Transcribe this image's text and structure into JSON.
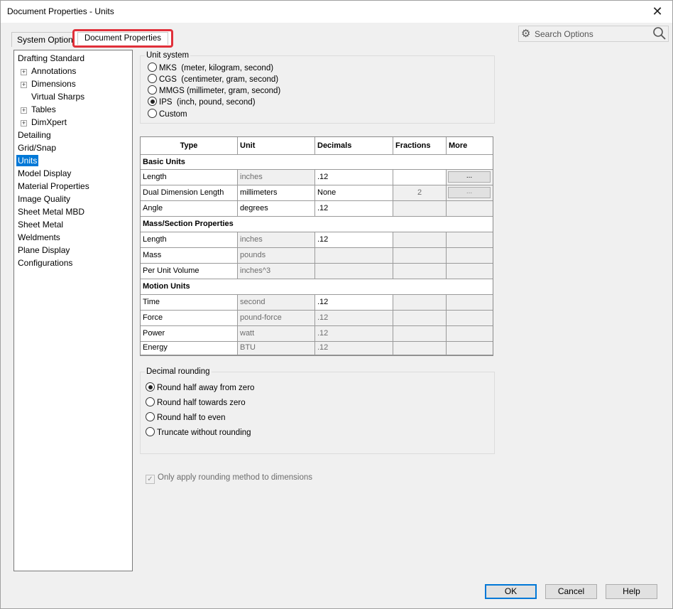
{
  "window": {
    "title": "Document Properties - Units",
    "close": "✕"
  },
  "tabs": {
    "system": "System Options",
    "document": "Document Properties"
  },
  "search": {
    "placeholder": "Search Options"
  },
  "tree": {
    "items": [
      {
        "label": "Drafting Standard"
      },
      {
        "label": "Annotations"
      },
      {
        "label": "Dimensions"
      },
      {
        "label": "Virtual Sharps"
      },
      {
        "label": "Tables"
      },
      {
        "label": "DimXpert"
      },
      {
        "label": "Detailing"
      },
      {
        "label": "Grid/Snap"
      },
      {
        "label": "Units"
      },
      {
        "label": "Model Display"
      },
      {
        "label": "Material Properties"
      },
      {
        "label": "Image Quality"
      },
      {
        "label": "Sheet Metal MBD"
      },
      {
        "label": "Sheet Metal"
      },
      {
        "label": "Weldments"
      },
      {
        "label": "Plane Display"
      },
      {
        "label": "Configurations"
      }
    ],
    "selected": "Units"
  },
  "unit_system": {
    "label": "Unit system",
    "options": [
      {
        "label": "MKS  (meter, kilogram, second)",
        "selected": false
      },
      {
        "label": "CGS  (centimeter, gram, second)",
        "selected": false
      },
      {
        "label": "MMGS (millimeter, gram, second)",
        "selected": false
      },
      {
        "label": "IPS  (inch, pound, second)",
        "selected": true
      },
      {
        "label": "Custom",
        "selected": false
      }
    ]
  },
  "table": {
    "headers": {
      "type": "Type",
      "unit": "Unit",
      "decimals": "Decimals",
      "fractions": "Fractions",
      "more": "More"
    },
    "sections": {
      "basic": "Basic Units",
      "mass": "Mass/Section Properties",
      "motion": "Motion Units"
    },
    "rows": [
      {
        "type": "Length",
        "unit": "inches",
        "decimals": ".12",
        "fractions": "",
        "more": "..."
      },
      {
        "type": "Dual Dimension Length",
        "unit": "millimeters",
        "decimals": "None",
        "fractions": "2",
        "more": "..."
      },
      {
        "type": "Angle",
        "unit": "degrees",
        "decimals": ".12",
        "fractions": "",
        "more": ""
      },
      {
        "type": "Length",
        "unit": "inches",
        "decimals": ".12",
        "fractions": "",
        "more": ""
      },
      {
        "type": "Mass",
        "unit": "pounds",
        "decimals": "",
        "fractions": "",
        "more": ""
      },
      {
        "type": "Per Unit Volume",
        "unit": "inches^3",
        "decimals": "",
        "fractions": "",
        "more": ""
      },
      {
        "type": "Time",
        "unit": "second",
        "decimals": ".12",
        "fractions": "",
        "more": ""
      },
      {
        "type": "Force",
        "unit": "pound-force",
        "decimals": ".12",
        "fractions": "",
        "more": ""
      },
      {
        "type": "Power",
        "unit": "watt",
        "decimals": ".12",
        "fractions": "",
        "more": ""
      },
      {
        "type": "Energy",
        "unit": "BTU",
        "decimals": ".12",
        "fractions": "",
        "more": ""
      }
    ]
  },
  "decimal_rounding": {
    "label": "Decimal rounding",
    "options": [
      {
        "label": "Round half away from zero",
        "selected": true
      },
      {
        "label": "Round half towards zero",
        "selected": false
      },
      {
        "label": "Round half to even",
        "selected": false
      },
      {
        "label": "Truncate without rounding",
        "selected": false
      }
    ]
  },
  "only_apply": {
    "label": "Only apply rounding method to dimensions",
    "checked": true,
    "mark": "✓"
  },
  "buttons": {
    "ok": "OK",
    "cancel": "Cancel",
    "help": "Help"
  }
}
